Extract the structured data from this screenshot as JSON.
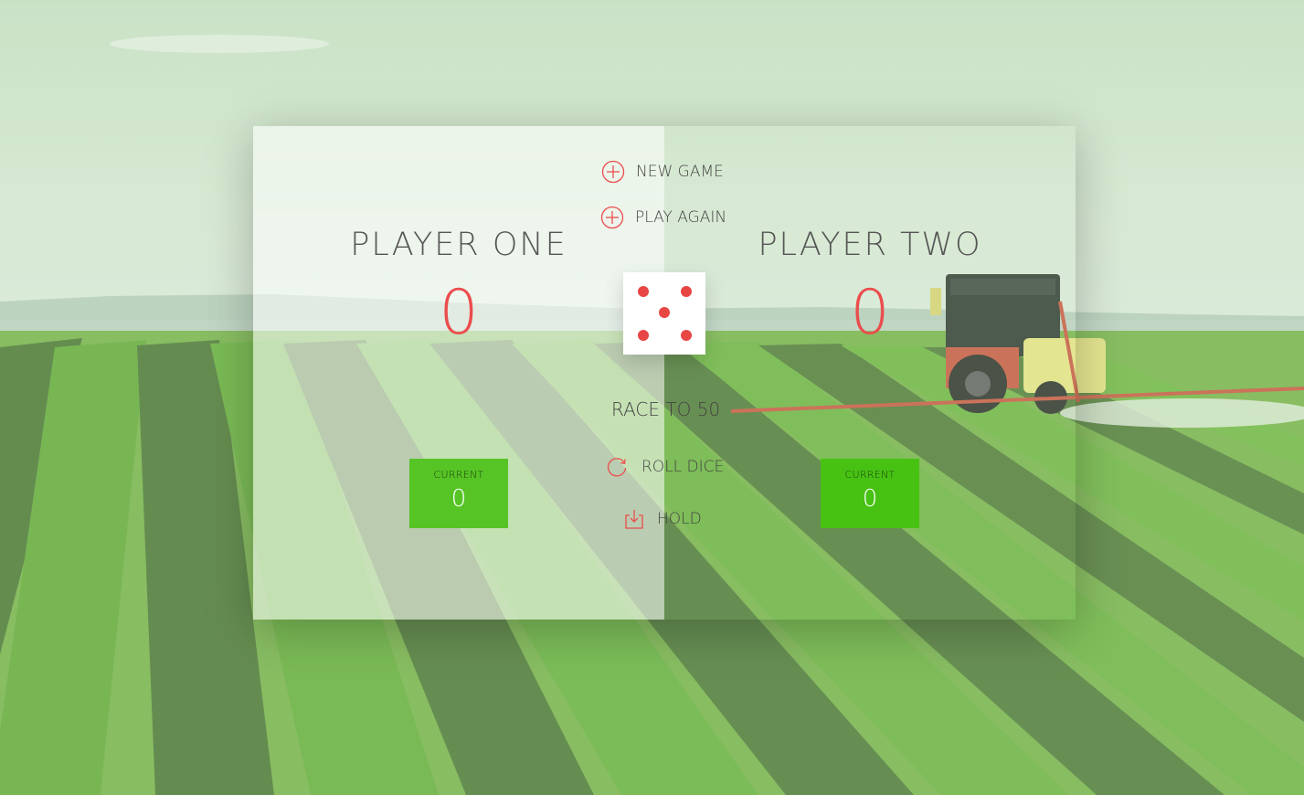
{
  "game": {
    "new_game_label": "NEW GAME",
    "play_again_label": "PLAY AGAIN",
    "roll_dice_label": "ROLL DICE",
    "hold_label": "HOLD",
    "race_to_label": "RACE TO 50",
    "dice_value": 5
  },
  "players": [
    {
      "name": "PLAYER ONE",
      "score": "0",
      "current_label": "CURRENT",
      "current_score": "0",
      "active": true
    },
    {
      "name": "PLAYER TWO",
      "score": "0",
      "current_label": "CURRENT",
      "current_score": "0",
      "active": false
    }
  ],
  "icons": {
    "new_game": "plus-circle-icon",
    "play_again": "plus-circle-icon",
    "roll_dice": "refresh-icon",
    "hold": "download-tray-icon"
  },
  "colors": {
    "accent": "#eb4d4d",
    "current_box": "#52c41a",
    "score": "#eb4d4d"
  }
}
